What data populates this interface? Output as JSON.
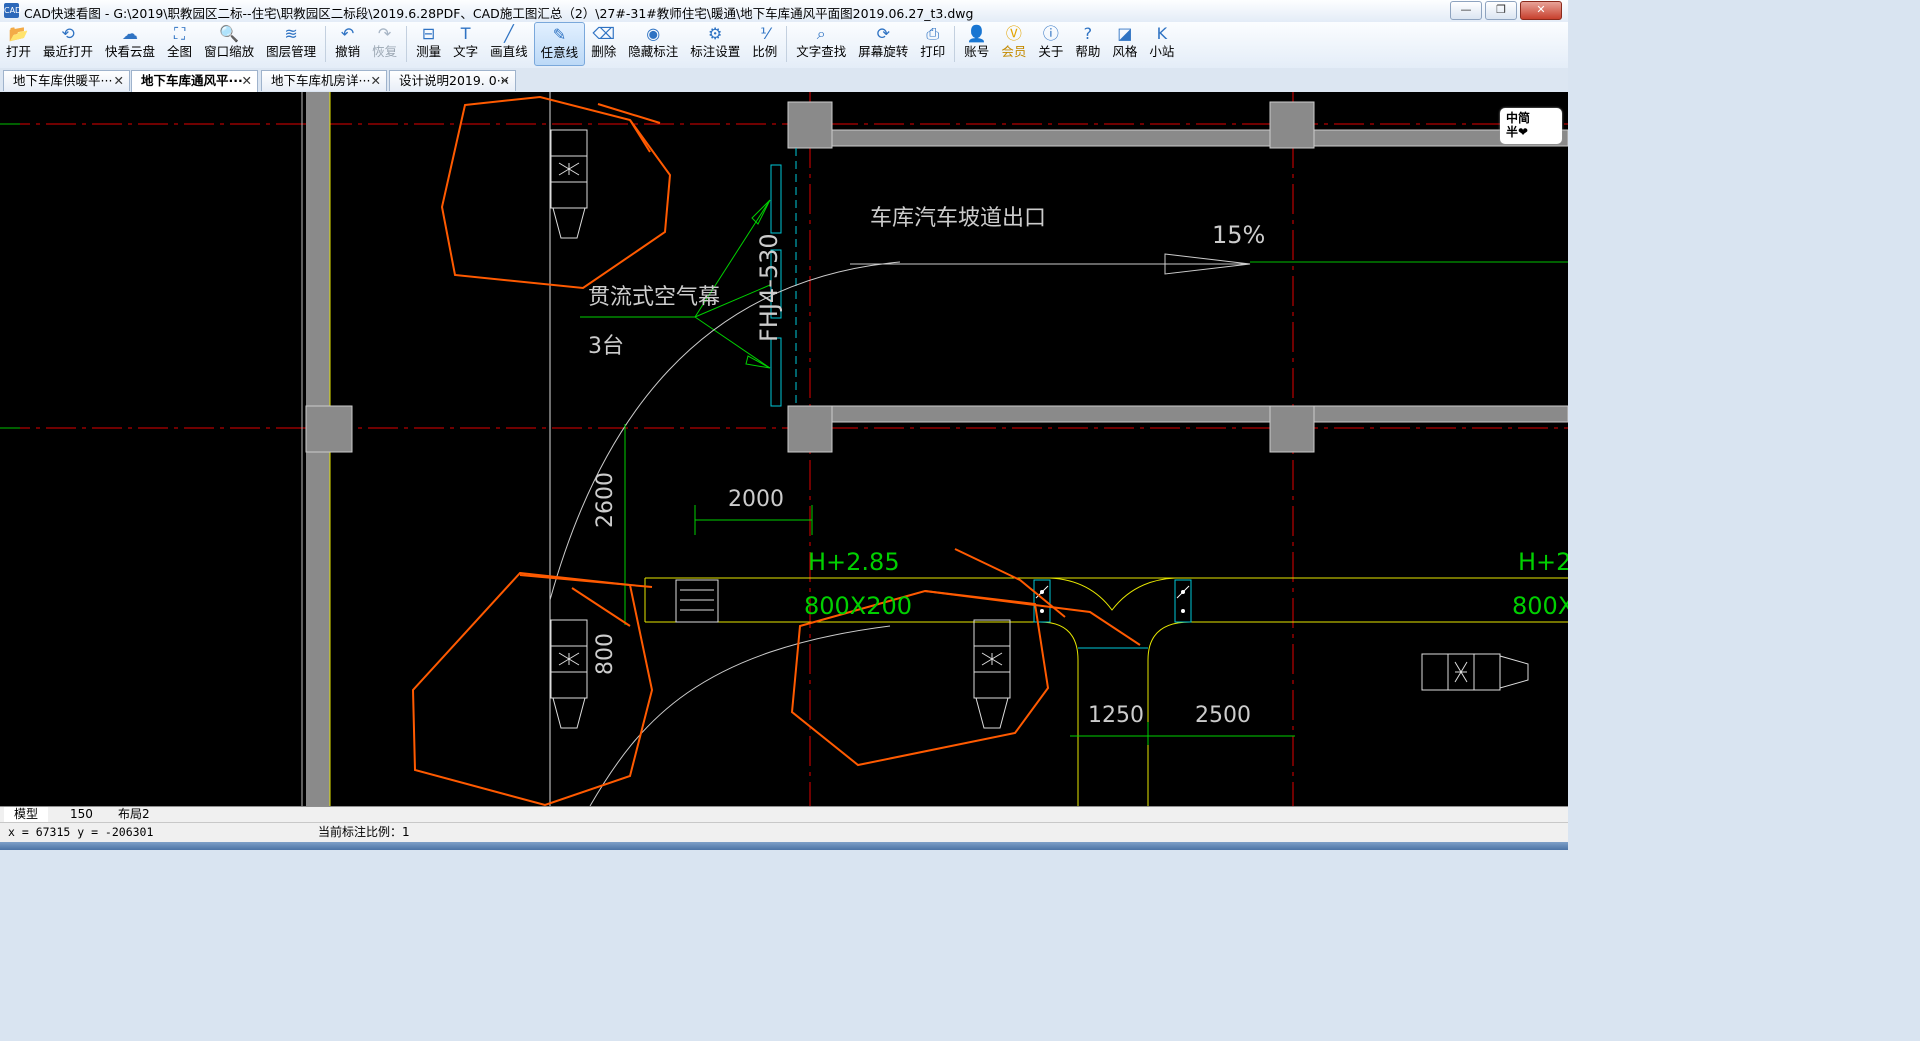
{
  "window": {
    "app_icon": "cad-icon",
    "title": "CAD快速看图 - G:\\2019\\职教园区二标--住宅\\职教园区二标段\\2019.6.28PDF、CAD施工图汇总（2）\\27#-31#教师住宅\\暖通\\地下车库通风平面图2019.06.27_t3.dwg",
    "minimize": "—",
    "restore": "❐",
    "close": "✕"
  },
  "toolbar": [
    {
      "id": "open",
      "label": "打开",
      "icon": "folder-icon",
      "glyph": "📂"
    },
    {
      "id": "recent",
      "label": "最近打开",
      "icon": "history-icon",
      "glyph": "⟲"
    },
    {
      "id": "cloud",
      "label": "快看云盘",
      "icon": "cloud-icon",
      "glyph": "☁"
    },
    {
      "id": "fullview",
      "label": "全图",
      "icon": "fit-view-icon",
      "glyph": "⛶"
    },
    {
      "id": "zoomwin",
      "label": "窗口缩放",
      "icon": "zoom-window-icon",
      "glyph": "🔍"
    },
    {
      "id": "layers",
      "label": "图层管理",
      "icon": "layers-icon",
      "glyph": "≋"
    },
    {
      "id": "undo",
      "label": "撤销",
      "icon": "undo-icon",
      "glyph": "↶"
    },
    {
      "id": "redo",
      "label": "恢复",
      "icon": "redo-icon",
      "glyph": "↷",
      "disabled": true
    },
    {
      "id": "measure",
      "label": "测量",
      "icon": "measure-icon",
      "glyph": "⊟"
    },
    {
      "id": "text",
      "label": "文字",
      "icon": "text-icon",
      "glyph": "T"
    },
    {
      "id": "line",
      "label": "画直线",
      "icon": "line-icon",
      "glyph": "╱"
    },
    {
      "id": "freeline",
      "label": "任意线",
      "icon": "freehand-icon",
      "glyph": "✎",
      "active": true
    },
    {
      "id": "delete",
      "label": "删除",
      "icon": "eraser-icon",
      "glyph": "⌫"
    },
    {
      "id": "hidemark",
      "label": "隐藏标注",
      "icon": "eye-icon",
      "glyph": "◉"
    },
    {
      "id": "marksetting",
      "label": "标注设置",
      "icon": "settings-icon",
      "glyph": "⚙"
    },
    {
      "id": "scale",
      "label": "比例",
      "icon": "scale-icon",
      "glyph": "⅟"
    },
    {
      "id": "findtext",
      "label": "文字查找",
      "icon": "find-text-icon",
      "glyph": "⌕"
    },
    {
      "id": "rotate",
      "label": "屏幕旋转",
      "icon": "rotate-icon",
      "glyph": "⟳"
    },
    {
      "id": "print",
      "label": "打印",
      "icon": "printer-icon",
      "glyph": "⎙"
    },
    {
      "id": "account",
      "label": "账号",
      "icon": "user-icon",
      "glyph": "👤"
    },
    {
      "id": "vip",
      "label": "会员",
      "icon": "vip-icon",
      "glyph": "Ⓥ",
      "vip": true
    },
    {
      "id": "about",
      "label": "关于",
      "icon": "info-icon",
      "glyph": "ⓘ"
    },
    {
      "id": "help",
      "label": "帮助",
      "icon": "help-icon",
      "glyph": "?"
    },
    {
      "id": "style",
      "label": "风格",
      "icon": "style-icon",
      "glyph": "◪"
    },
    {
      "id": "station",
      "label": "小站",
      "icon": "k-station-icon",
      "glyph": "K"
    }
  ],
  "doc_tabs": [
    {
      "label": "地下车库供暖平···",
      "active": false
    },
    {
      "label": "地下车库通风平···",
      "active": true
    },
    {
      "label": "地下车库机房详···",
      "active": false
    },
    {
      "label": "设计说明2019. 0···",
      "active": false
    }
  ],
  "tab_close": "✕",
  "logo": {
    "line1": "中简",
    "line2": "半❤"
  },
  "drawing": {
    "ramp_exit": "车库汽车坡道出口",
    "slope": "15%",
    "air_curtain": "贯流式空气幕",
    "air_curtain_qty": "3台",
    "unit_model": "FHJ4-530",
    "dim_2000": "2000",
    "dim_2600": "2600",
    "dim_800": "800",
    "dim_1250": "1250",
    "dim_2500": "2500",
    "height_1": "H+2.85",
    "duct_size_1": "800X200",
    "height_2": "H+2.",
    "duct_size_2": "800X"
  },
  "layout_tabs": [
    {
      "label": "模型",
      "active": true
    },
    {
      "label": "150",
      "active": false
    },
    {
      "label": "布局2",
      "active": false
    }
  ],
  "status": {
    "coords": "x = 67315  y = -206301",
    "scale_text": "当前标注比例：1"
  }
}
